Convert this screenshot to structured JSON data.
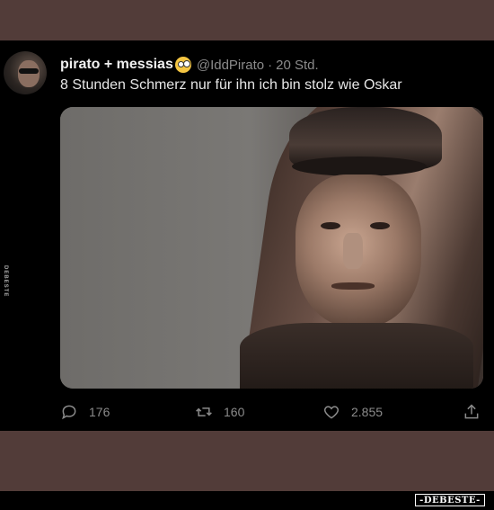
{
  "tweet": {
    "display_name": "pirato + messias",
    "emoji": "face-with-monocle-emoji",
    "handle": "@IddPirato",
    "separator": "·",
    "time": "20 Std.",
    "text": "8 Stunden Schmerz nur für ihn ich bin stolz wie Oskar",
    "media_subject": "tattoo-portrait-photo"
  },
  "actions": {
    "reply": {
      "icon": "reply-icon",
      "count": "176"
    },
    "retweet": {
      "icon": "retweet-icon",
      "count": "160"
    },
    "like": {
      "icon": "heart-icon",
      "count": "2.855"
    },
    "share": {
      "icon": "share-icon"
    }
  },
  "watermark": {
    "side": "DEBESTE",
    "logo": "-DEBESTE-"
  },
  "colors": {
    "band": "#523c39",
    "background": "#000000",
    "text": "#e6e6e6",
    "muted": "#8b8b8b"
  }
}
